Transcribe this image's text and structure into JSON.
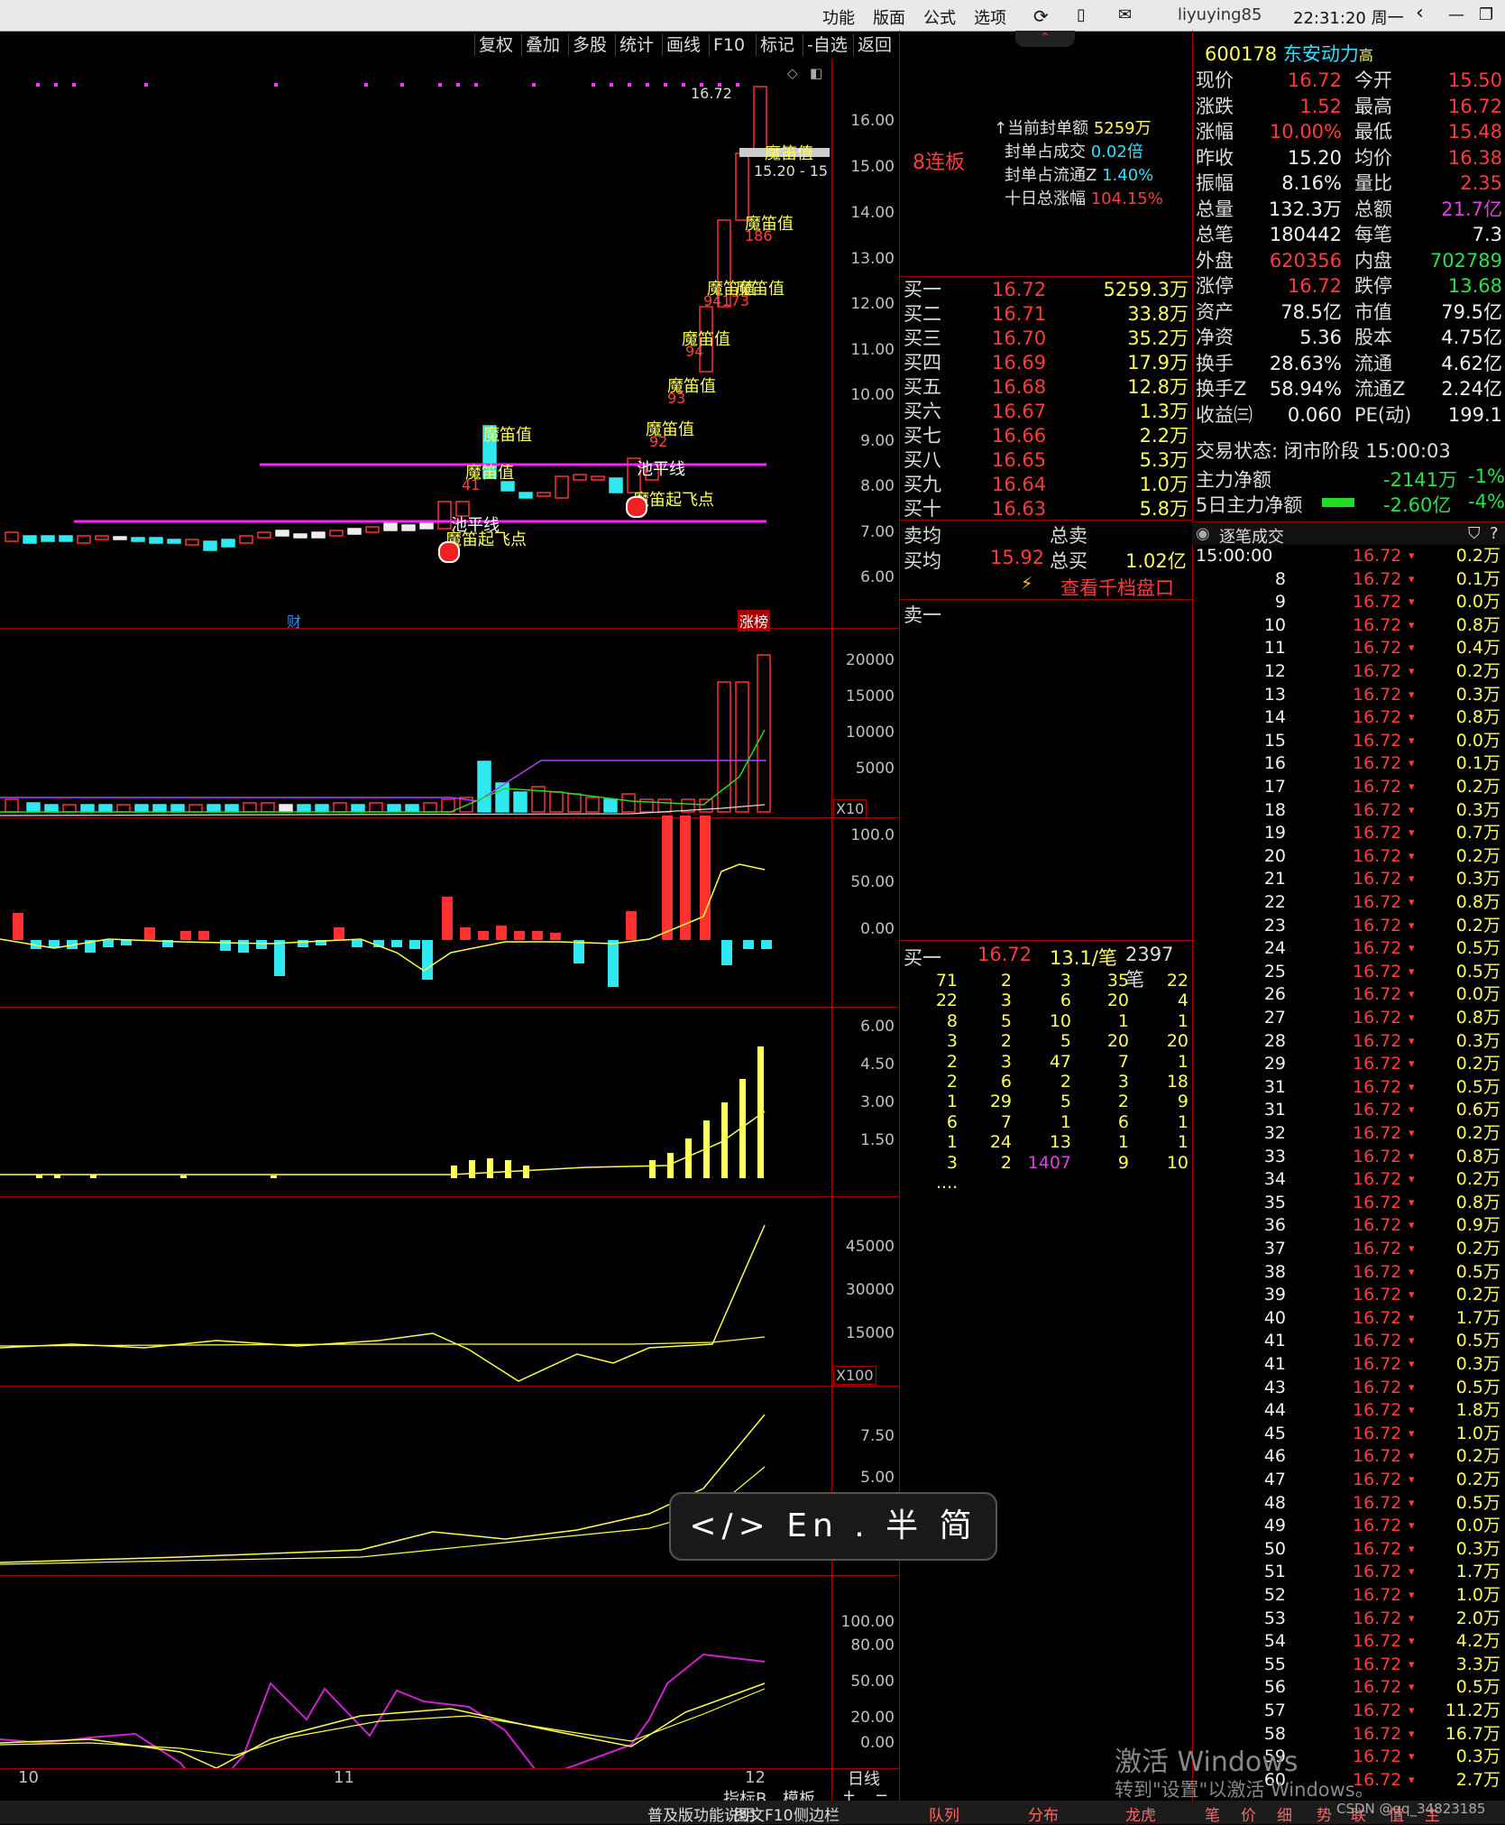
{
  "topbar": {
    "menus": [
      "功能",
      "版面",
      "公式",
      "选项"
    ],
    "user": "liyuying85",
    "clock": "22:31:20 周一"
  },
  "chart_toolbar": [
    "复权",
    "叠加",
    "多股",
    "统计",
    "画线",
    "F10",
    "标记",
    "-自选",
    "返回"
  ],
  "main_chart": {
    "price_axis": [
      "16.00",
      "15.00",
      "14.00",
      "13.00",
      "12.00",
      "11.00",
      "10.00",
      "9.00",
      "8.00",
      "7.00",
      "6.00"
    ],
    "high_label": "16.72",
    "annot_mmz": "魔笛值",
    "annot_takeoff": "魔笛起飞点",
    "annot_pool": "池平线",
    "range_label": "15.20 - 15",
    "num_186": "186",
    "num_94173": "94173",
    "num_94": "94",
    "num_93": "93",
    "num_92": "92",
    "num_41": "41",
    "cai": "财",
    "zhangbang": "涨榜",
    "x_labels": [
      "10",
      "11",
      "12"
    ],
    "lianban": "8连板",
    "seal_info": [
      {
        "k": "当前封单额",
        "v": "5259万"
      },
      {
        "k": "封单占成交",
        "v": "0.02倍"
      },
      {
        "k": "封单占流通Z",
        "v": "1.40%"
      },
      {
        "k": "十日总涨幅",
        "v": "104.15%"
      }
    ]
  },
  "volume_axis": [
    "20000",
    "15000",
    "10000",
    "5000"
  ],
  "volume_mult": "X10",
  "macd_axis": [
    "100.0",
    "50.00",
    "0.00"
  ],
  "p3_axis": [
    "6.00",
    "4.50",
    "3.00",
    "1.50"
  ],
  "p4_axis": [
    "45000",
    "30000",
    "15000"
  ],
  "p4_mult": "X100",
  "p5_axis": [
    "7.50",
    "5.00"
  ],
  "p6_axis": [
    "100.00",
    "80.00",
    "50.00",
    "20.00",
    "0.00"
  ],
  "bottom_tabs": [
    "指标B",
    "模板",
    "+",
    "−",
    "日线"
  ],
  "quote": {
    "code": "600178",
    "name": "东安动力",
    "tag": "高",
    "rows": [
      [
        "现价",
        "16.72",
        "今开",
        "15.50"
      ],
      [
        "涨跌",
        "1.52",
        "最高",
        "16.72"
      ],
      [
        "涨幅",
        "10.00%",
        "最低",
        "15.48"
      ],
      [
        "昨收",
        "15.20",
        "均价",
        "16.38"
      ],
      [
        "振幅",
        "8.16%",
        "量比",
        "2.35"
      ],
      [
        "总量",
        "132.3万",
        "总额",
        "21.7亿"
      ],
      [
        "总笔",
        "180442",
        "每笔",
        "7.3"
      ],
      [
        "外盘",
        "620356",
        "内盘",
        "702789"
      ],
      [
        "涨停",
        "16.72",
        "跌停",
        "13.68"
      ],
      [
        "资产",
        "78.5亿",
        "市值",
        "79.5亿"
      ],
      [
        "净资",
        "5.36",
        "股本",
        "4.75亿"
      ],
      [
        "换手",
        "28.63%",
        "流通",
        "4.62亿"
      ],
      [
        "换手Z",
        "58.94%",
        "流通Z",
        "2.24亿"
      ],
      [
        "收益㈢",
        "0.060",
        "PE(动)",
        "199.1"
      ]
    ],
    "status": "交易状态: 闭市阶段 15:00:03",
    "main_net": {
      "label": "主力净额",
      "value": "-2141万",
      "pct": "-1%"
    },
    "main_net5": {
      "label": "5日主力净额",
      "value": "-2.60亿",
      "pct": "-4%"
    }
  },
  "orderbook": {
    "buys": [
      [
        "买一",
        "16.72",
        "5259.3万"
      ],
      [
        "买二",
        "16.71",
        "33.8万"
      ],
      [
        "买三",
        "16.70",
        "35.2万"
      ],
      [
        "买四",
        "16.69",
        "17.9万"
      ],
      [
        "买五",
        "16.68",
        "12.8万"
      ],
      [
        "买六",
        "16.67",
        "1.3万"
      ],
      [
        "买七",
        "16.66",
        "2.2万"
      ],
      [
        "买八",
        "16.65",
        "5.3万"
      ],
      [
        "买九",
        "16.64",
        "1.0万"
      ],
      [
        "买十",
        "16.63",
        "5.8万"
      ]
    ],
    "sell_avg": "卖均",
    "total_sell": "总卖",
    "buy_avg": "买均",
    "buy_avg_val": "15.92",
    "total_buy": "总买",
    "total_buy_val": "1.02亿",
    "ten_depth": "查看千档盘口",
    "sell1": "卖一",
    "queue_header": {
      "label": "买一",
      "price": "16.72",
      "avg": "13.1/笔",
      "count": "2397笔"
    },
    "queue": [
      [
        "71",
        "2",
        "3",
        "35",
        "22"
      ],
      [
        "22",
        "3",
        "6",
        "20",
        "4"
      ],
      [
        "8",
        "5",
        "10",
        "1",
        "1"
      ],
      [
        "3",
        "2",
        "5",
        "20",
        "20"
      ],
      [
        "2",
        "3",
        "47",
        "7",
        "1"
      ],
      [
        "2",
        "6",
        "2",
        "3",
        "18"
      ],
      [
        "1",
        "29",
        "5",
        "2",
        "9"
      ],
      [
        "6",
        "7",
        "1",
        "6",
        "1"
      ],
      [
        "1",
        "24",
        "13",
        "1",
        "1"
      ],
      [
        "3",
        "2",
        "1407",
        "9",
        "10"
      ]
    ],
    "queue_more": "...."
  },
  "trades": {
    "title": "逐笔成交",
    "rows": [
      [
        "15:00:00",
        "16.72",
        "0.2万"
      ],
      [
        "8",
        "16.72",
        "0.1万"
      ],
      [
        "9",
        "16.72",
        "0.0万"
      ],
      [
        "10",
        "16.72",
        "0.8万"
      ],
      [
        "11",
        "16.72",
        "0.4万"
      ],
      [
        "12",
        "16.72",
        "0.2万"
      ],
      [
        "13",
        "16.72",
        "0.3万"
      ],
      [
        "14",
        "16.72",
        "0.8万"
      ],
      [
        "15",
        "16.72",
        "0.0万"
      ],
      [
        "16",
        "16.72",
        "0.1万"
      ],
      [
        "17",
        "16.72",
        "0.2万"
      ],
      [
        "18",
        "16.72",
        "0.3万"
      ],
      [
        "19",
        "16.72",
        "0.7万"
      ],
      [
        "20",
        "16.72",
        "0.2万"
      ],
      [
        "21",
        "16.72",
        "0.3万"
      ],
      [
        "22",
        "16.72",
        "0.8万"
      ],
      [
        "23",
        "16.72",
        "0.2万"
      ],
      [
        "24",
        "16.72",
        "0.5万"
      ],
      [
        "25",
        "16.72",
        "0.5万"
      ],
      [
        "26",
        "16.72",
        "0.0万"
      ],
      [
        "27",
        "16.72",
        "0.8万"
      ],
      [
        "28",
        "16.72",
        "0.3万"
      ],
      [
        "29",
        "16.72",
        "0.2万"
      ],
      [
        "31",
        "16.72",
        "0.5万"
      ],
      [
        "31",
        "16.72",
        "0.6万"
      ],
      [
        "32",
        "16.72",
        "0.2万"
      ],
      [
        "33",
        "16.72",
        "0.8万"
      ],
      [
        "34",
        "16.72",
        "0.2万"
      ],
      [
        "35",
        "16.72",
        "0.8万"
      ],
      [
        "36",
        "16.72",
        "0.9万"
      ],
      [
        "37",
        "16.72",
        "0.2万"
      ],
      [
        "38",
        "16.72",
        "0.5万"
      ],
      [
        "39",
        "16.72",
        "0.2万"
      ],
      [
        "40",
        "16.72",
        "1.7万"
      ],
      [
        "41",
        "16.72",
        "0.5万"
      ],
      [
        "41",
        "16.72",
        "0.3万"
      ],
      [
        "43",
        "16.72",
        "0.5万"
      ],
      [
        "44",
        "16.72",
        "1.8万"
      ],
      [
        "45",
        "16.72",
        "1.0万"
      ],
      [
        "46",
        "16.72",
        "0.2万"
      ],
      [
        "47",
        "16.72",
        "0.2万"
      ],
      [
        "48",
        "16.72",
        "0.5万"
      ],
      [
        "49",
        "16.72",
        "0.0万"
      ],
      [
        "50",
        "16.72",
        "0.3万"
      ],
      [
        "51",
        "16.72",
        "1.7万"
      ],
      [
        "52",
        "16.72",
        "1.0万"
      ],
      [
        "53",
        "16.72",
        "2.0万"
      ],
      [
        "54",
        "16.72",
        "4.2万"
      ],
      [
        "55",
        "16.72",
        "3.3万"
      ],
      [
        "56",
        "16.72",
        "0.5万"
      ],
      [
        "57",
        "16.72",
        "11.2万"
      ],
      [
        "58",
        "16.72",
        "16.7万"
      ],
      [
        "59",
        "16.72",
        "0.3万"
      ],
      [
        "60",
        "16.72",
        "2.7万"
      ]
    ]
  },
  "ime": "</> En . 半 简",
  "watermark": "激活 Windows",
  "watermark2": "转到\"设置\"以激活 Windows。",
  "csdn": "CSDN @qq_34823185",
  "bottom_strip": [
    "普及版功能说明",
    "图文F10",
    "侧边栏",
    "队列",
    "分布",
    "龙虎",
    "笔",
    "价",
    "细",
    "势",
    "联",
    "值",
    "主"
  ]
}
